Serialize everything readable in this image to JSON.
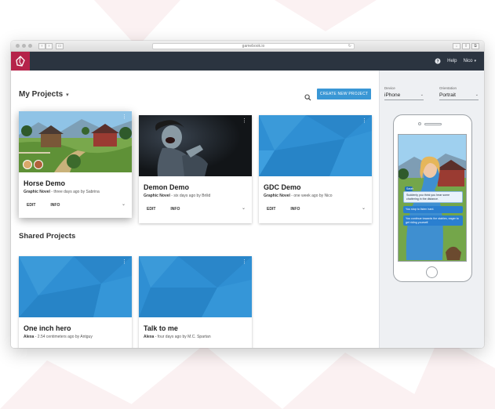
{
  "browser": {
    "url": "gamebook.io",
    "reload_icon": "reload-icon",
    "nav_back": "‹",
    "nav_forward": "›"
  },
  "appbar": {
    "help": "Help",
    "user": "Nico",
    "logo_icon": "gamebook-logo",
    "help_icon": "help-icon"
  },
  "main": {
    "my_projects_title": "My Projects",
    "shared_projects_title": "Shared Projects",
    "create_button": "CREATE NEW PROJECT",
    "my_projects": [
      {
        "title": "Horse Demo",
        "type": "Graphic Novel",
        "meta": " - three days ago by Sabrina",
        "edit": "EDIT",
        "info": "INFO"
      },
      {
        "title": "Demon Demo",
        "type": "Graphic Novel",
        "meta": " - six days ago by Brilid",
        "edit": "EDIT",
        "info": "INFO"
      },
      {
        "title": "GDC Demo",
        "type": "Graphic Novel",
        "meta": " - one week ago by Nico",
        "edit": "EDIT",
        "info": "INFO"
      }
    ],
    "shared_projects": [
      {
        "title": "One inch hero",
        "type": "Alexa",
        "meta": " - 2.54 centimeters ago by Antguy"
      },
      {
        "title": "Talk to me",
        "type": "Alexa",
        "meta": " - four days ago by M.C. Spartan"
      }
    ]
  },
  "preview": {
    "device_label": "Device",
    "device_value": "iPhone",
    "orientation_label": "Orientation",
    "orientation_value": "Portrait",
    "name_tag": "Sarah",
    "dialogue_1": "Suddenly you think you hear some chattering in the distance.",
    "choice_1": "You stop to listen hard.",
    "choice_2": "You continue towards the stables, eager to get riding yourself."
  },
  "colors": {
    "accent": "#3a97d5",
    "appbar": "#2b3440",
    "logo": "#b5234a",
    "card_blue": "#2f8fd3"
  }
}
